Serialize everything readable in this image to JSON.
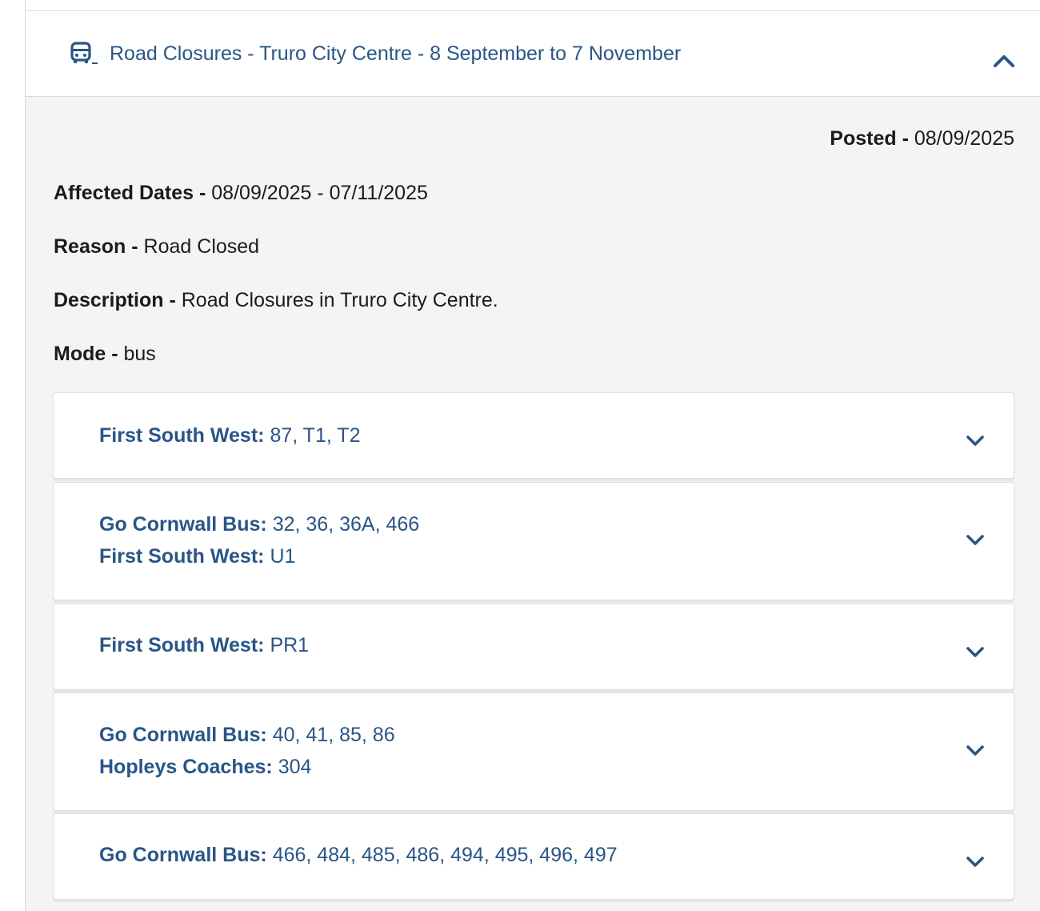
{
  "header": {
    "title": "Road Closures - Truro City Centre - 8 September to 7 November",
    "icon": "bus-icon",
    "toggle_icon": "chevron-up-icon",
    "link_color": "#2a5587"
  },
  "details": {
    "posted_label": "Posted -",
    "posted_value": "08/09/2025",
    "affected_dates_label": "Affected Dates -",
    "affected_dates_value": "08/09/2025 - 07/11/2025",
    "reason_label": "Reason -",
    "reason_value": "Road Closed",
    "description_label": "Description -",
    "description_value": "Road Closures in Truro City Centre.",
    "mode_label": "Mode -",
    "mode_value": "bus"
  },
  "services": [
    {
      "lines": [
        {
          "operator": "First South West:",
          "routes": "87, T1, T2"
        }
      ],
      "toggle_icon": "chevron-down-icon"
    },
    {
      "lines": [
        {
          "operator": "Go Cornwall Bus:",
          "routes": "32, 36, 36A, 466"
        },
        {
          "operator": "First South West:",
          "routes": "U1"
        }
      ],
      "toggle_icon": "chevron-down-icon"
    },
    {
      "lines": [
        {
          "operator": "First South West:",
          "routes": "PR1"
        }
      ],
      "toggle_icon": "chevron-down-icon"
    },
    {
      "lines": [
        {
          "operator": "Go Cornwall Bus:",
          "routes": "40, 41, 85, 86"
        },
        {
          "operator": "Hopleys Coaches:",
          "routes": "304"
        }
      ],
      "toggle_icon": "chevron-down-icon"
    },
    {
      "lines": [
        {
          "operator": "Go Cornwall Bus:",
          "routes": "466, 484, 485, 486, 494, 495, 496, 497"
        }
      ],
      "toggle_icon": "chevron-down-icon"
    }
  ]
}
